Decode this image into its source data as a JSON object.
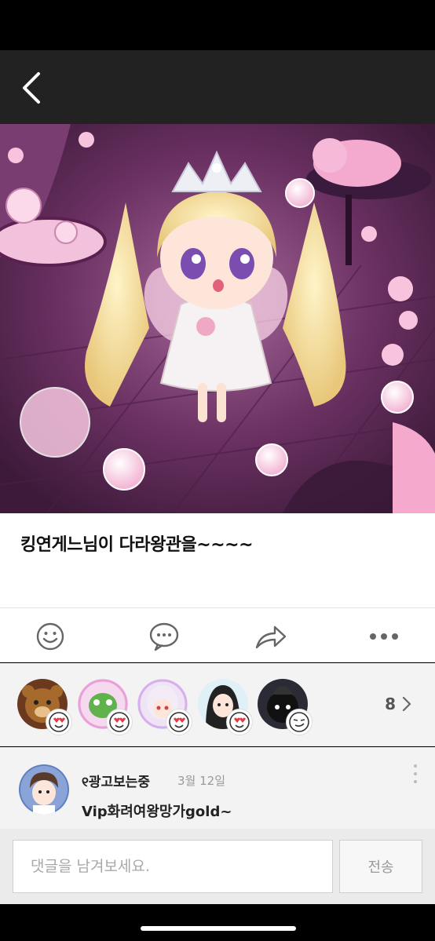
{
  "nav": {
    "back_icon": "chevron-left-icon"
  },
  "post": {
    "title": "킹연게느님이 다라왕관을~~~~"
  },
  "actions": [
    {
      "icon": "smiley-icon"
    },
    {
      "icon": "speech-bubble-icon"
    },
    {
      "icon": "share-arrow-icon"
    },
    {
      "icon": "more-dots-icon"
    }
  ],
  "reactions": {
    "count": "8",
    "badge_icon": "heart-eyes-emoji-icon"
  },
  "comment": {
    "author": "୧광고보는중",
    "date": "3월 12일",
    "text": "Vip화려여왕망가gold~"
  },
  "composer": {
    "placeholder": "댓글을 남겨보세요.",
    "send_label": "전송"
  },
  "colors": {
    "nav_bg": "#222222",
    "hero_bg": "#5b2a55",
    "panel_bg": "#f3f3f3"
  }
}
